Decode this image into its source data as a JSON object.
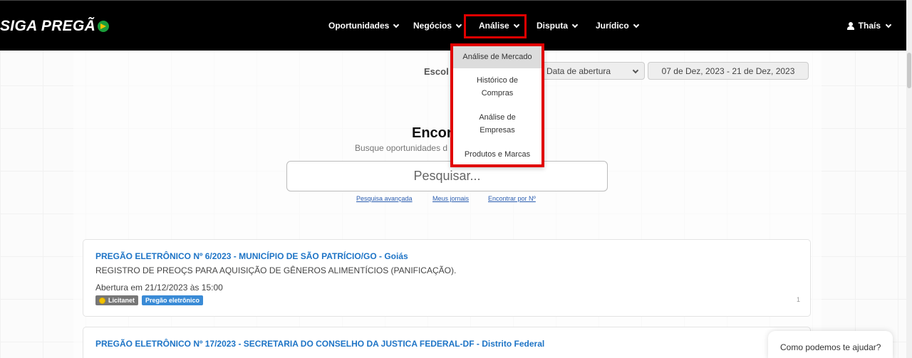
{
  "header": {
    "logo_text": "SIGA PREGÃ",
    "nav": [
      {
        "label": "Oportunidades"
      },
      {
        "label": "Negócios"
      },
      {
        "label": "Análise"
      },
      {
        "label": "Disputa"
      },
      {
        "label": "Jurídico"
      }
    ],
    "user_name": "Thaís"
  },
  "dropdown": {
    "items": [
      {
        "label": "Análise de Mercado"
      },
      {
        "label": "Histórico de Compras"
      },
      {
        "label": "Análise de Empresas"
      },
      {
        "label": "Produtos e Marcas"
      }
    ]
  },
  "filters": {
    "label": "Escol",
    "date_type": "Data de abertura",
    "date_range": "07 de Dez, 2023 - 21 de Dez, 2023"
  },
  "search": {
    "heading": "Encor",
    "subheading": "Busque oportunidades d",
    "placeholder": "Pesquisar...",
    "links": [
      "Pesquisa avançada",
      "Meus jornais",
      "Encontrar por Nº"
    ]
  },
  "results": [
    {
      "title": "PREGÃO ELETRÔNICO Nº 6/2023 - MUNICÍPIO DE SÃO PATRÍCIO/GO - Goiás",
      "description": "REGISTRO DE PREOÇS PARA AQUISIÇÃO DE GÊNEROS ALIMENTÍCIOS (PANIFICAÇÃO).",
      "opening": "Abertura em 21/12/2023 às 15:00",
      "badges": [
        "Licitanet",
        "Pregão eletrônico"
      ],
      "count": "1"
    },
    {
      "title": "PREGÃO ELETRÔNICO Nº 17/2023 - SECRETARIA DO CONSELHO DA JUSTICA FEDERAL-DF - Distrito Federal"
    }
  ],
  "chat": {
    "label": "Como podemos te ajudar?"
  },
  "colors": {
    "topbar": "#000000",
    "highlight": "#e10000",
    "link": "#1e74c6"
  }
}
